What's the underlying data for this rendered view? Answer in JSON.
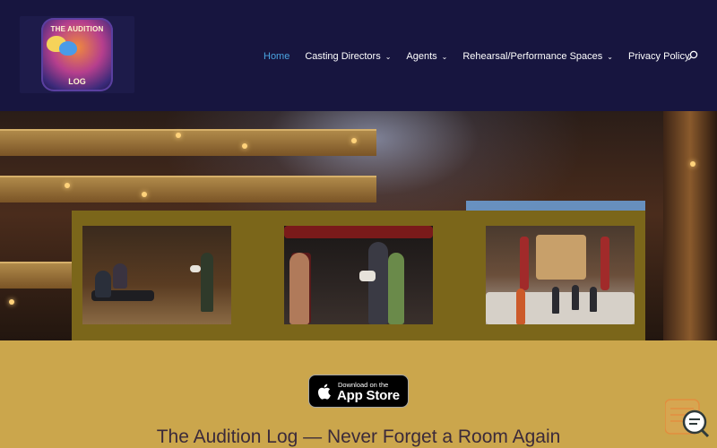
{
  "header": {
    "logo": {
      "line1": "THE AUDITION",
      "line2": "LOG"
    },
    "nav": [
      {
        "label": "Home",
        "active": true,
        "dropdown": false
      },
      {
        "label": "Casting Directors",
        "active": false,
        "dropdown": true
      },
      {
        "label": "Agents",
        "active": false,
        "dropdown": true
      },
      {
        "label": "Rehearsal/Performance Spaces",
        "active": false,
        "dropdown": true
      },
      {
        "label": "Privacy Policy",
        "active": false,
        "dropdown": false
      }
    ],
    "search_icon": "search-icon"
  },
  "hero": {
    "gallery_images": [
      "audition-panel-photo",
      "scene-reading-photo",
      "rehearsal-stage-photo"
    ]
  },
  "app_store": {
    "small": "Download on the",
    "big": "App Store"
  },
  "tagline": "The Audition Log — Never Forget a Room Again",
  "colors": {
    "header_bg": "#17153f",
    "nav_active": "#4aa3e0",
    "page_bg": "#cba64c",
    "gallery_bg": "#7b661a",
    "tagline": "#3b2a3a"
  }
}
